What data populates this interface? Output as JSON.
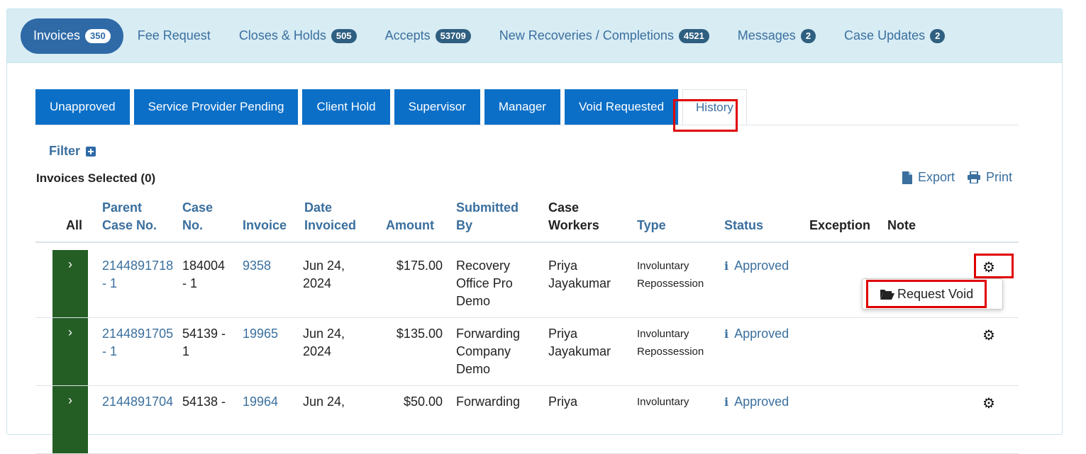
{
  "top_tabs": [
    {
      "label": "Invoices",
      "badge": "350"
    },
    {
      "label": "Fee Request",
      "badge": ""
    },
    {
      "label": "Closes & Holds",
      "badge": "505"
    },
    {
      "label": "Accepts",
      "badge": "53709"
    },
    {
      "label": "New Recoveries / Completions",
      "badge": "4521"
    },
    {
      "label": "Messages",
      "badge": "2"
    },
    {
      "label": "Case Updates",
      "badge": "2"
    }
  ],
  "sub_tabs": [
    "Unapproved",
    "Service Provider Pending",
    "Client Hold",
    "Supervisor",
    "Manager",
    "Void Requested",
    "History"
  ],
  "filter_label": "Filter",
  "selected_label": "Invoices Selected (0)",
  "export_label": "Export",
  "print_label": "Print",
  "headers": {
    "all": "All",
    "parent_case_1": "Parent",
    "parent_case_2": "Case No.",
    "case_1": "Case",
    "case_2": "No.",
    "invoice": "Invoice",
    "date_1": "Date",
    "date_2": "Invoiced",
    "amount": "Amount",
    "submitted_1": "Submitted",
    "submitted_2": "By",
    "workers_1": "Case",
    "workers_2": "Workers",
    "type": "Type",
    "status": "Status",
    "exception": "Exception",
    "note": "Note"
  },
  "rows": [
    {
      "parent_1": "2144891718",
      "parent_2": "- 1",
      "case_1": "184004",
      "case_2": "- 1",
      "invoice": "9358",
      "date_1": "Jun 24,",
      "date_2": "2024",
      "amount": "$175.00",
      "sub_1": "Recovery",
      "sub_2": "Office Pro",
      "sub_3": "Demo",
      "worker_1": "Priya",
      "worker_2": "Jayakumar",
      "type_1": "Involuntary",
      "type_2": "Repossession",
      "status": "Approved"
    },
    {
      "parent_1": "2144891705",
      "parent_2": "- 1",
      "case_1": "54139 -",
      "case_2": "1",
      "invoice": "19965",
      "date_1": "Jun 24,",
      "date_2": "2024",
      "amount": "$135.00",
      "sub_1": "Forwarding",
      "sub_2": "Company",
      "sub_3": "Demo",
      "worker_1": "Priya",
      "worker_2": "Jayakumar",
      "type_1": "Involuntary",
      "type_2": "Repossession",
      "status": "Approved"
    },
    {
      "parent_1": "2144891704",
      "parent_2": "",
      "case_1": "54138 -",
      "case_2": "",
      "invoice": "19964",
      "date_1": "Jun 24,",
      "date_2": "",
      "amount": "$50.00",
      "sub_1": "Forwarding",
      "sub_2": "",
      "sub_3": "",
      "worker_1": "Priya",
      "worker_2": "",
      "type_1": "Involuntary",
      "type_2": "",
      "status": "Approved"
    }
  ],
  "context_menu": {
    "label": "Request Void"
  },
  "icons": {
    "expand": "chevron-right-icon",
    "info": "info-icon",
    "gear": "gear-icon",
    "export": "file-icon",
    "print": "printer-icon",
    "folder": "folder-open-icon",
    "filter": "plus-square-icon"
  },
  "colors": {
    "accent": "#0b6fc7",
    "link": "#3a6f9e",
    "expander": "#255e25",
    "highlight": "#e00000",
    "nav_bg": "#d8ecf4"
  }
}
